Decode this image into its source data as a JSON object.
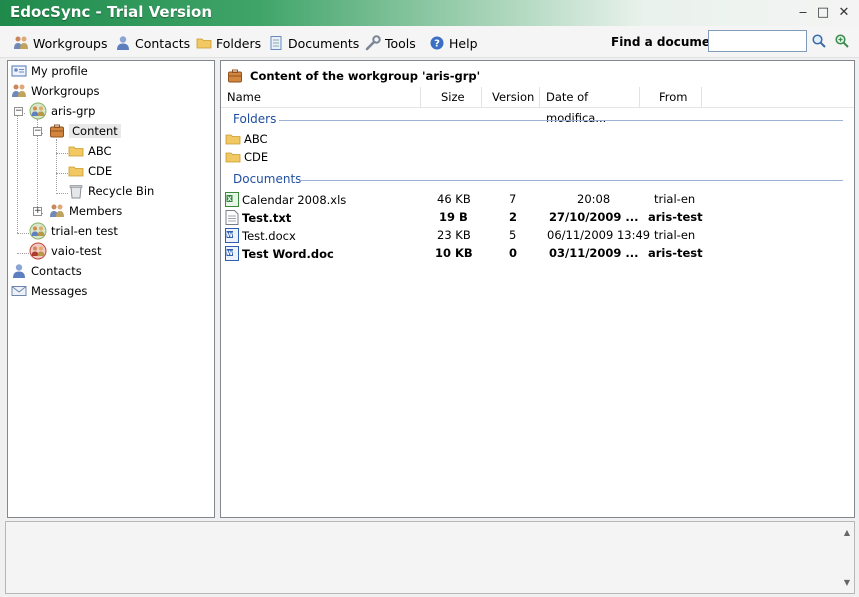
{
  "window": {
    "title": "EdocSync - Trial Version",
    "minimize_glyph": "‒",
    "maximize_glyph": "□",
    "close_glyph": "✕"
  },
  "menu": {
    "items": [
      {
        "label": "Workgroups",
        "icon": "workgroups-icon"
      },
      {
        "label": "Contacts",
        "icon": "contacts-icon"
      },
      {
        "label": "Folders",
        "icon": "folder-icon"
      },
      {
        "label": "Documents",
        "icon": "document-icon"
      },
      {
        "label": "Tools",
        "icon": "wrench-icon"
      },
      {
        "label": "Help",
        "icon": "help-icon"
      }
    ],
    "find_label": "Find a document",
    "find_value": ""
  },
  "tree": {
    "nodes": [
      {
        "label": "My profile",
        "icon": "profile-card-icon"
      },
      {
        "label": "Workgroups",
        "icon": "workgroups-icon"
      },
      {
        "label": "aris-grp",
        "icon": "group-icon"
      },
      {
        "label": "Content",
        "icon": "briefcase-icon"
      },
      {
        "label": "ABC",
        "icon": "folder-icon"
      },
      {
        "label": "CDE",
        "icon": "folder-icon"
      },
      {
        "label": "Recycle Bin",
        "icon": "recycle-bin-icon"
      },
      {
        "label": "Members",
        "icon": "members-icon"
      },
      {
        "label": "trial-en test",
        "icon": "group-icon"
      },
      {
        "label": "vaio-test",
        "icon": "group-error-icon"
      },
      {
        "label": "Contacts",
        "icon": "contacts-icon"
      },
      {
        "label": "Messages",
        "icon": "envelope-icon"
      }
    ],
    "expander_minus": "−",
    "expander_plus": "+"
  },
  "content": {
    "header": "Content of the workgroup 'aris-grp'",
    "columns": [
      "Name",
      "Size",
      "Version",
      "Date of modifica...",
      "From"
    ],
    "folders_label": "Folders",
    "folders": [
      "ABC",
      "CDE"
    ],
    "documents_label": "Documents",
    "documents": [
      {
        "name": "Calendar 2008.xls",
        "size": "46 KB",
        "version": "7",
        "date": "20:08",
        "from": "trial-en",
        "bold": false,
        "icon": "excel-icon"
      },
      {
        "name": "Test.txt",
        "size": "19 B",
        "version": "2",
        "date": "27/10/2009 ...",
        "from": "aris-test",
        "bold": true,
        "icon": "text-file-icon"
      },
      {
        "name": "Test.docx",
        "size": "23 KB",
        "version": "5",
        "date": "06/11/2009 13:49",
        "from": "trial-en",
        "bold": false,
        "icon": "word-icon"
      },
      {
        "name": "Test Word.doc",
        "size": "10 KB",
        "version": "0",
        "date": "03/11/2009 ...",
        "from": "aris-test",
        "bold": true,
        "icon": "word-icon"
      }
    ]
  },
  "bottom": {
    "scroll_up_glyph": "▲",
    "scroll_down_glyph": "▼"
  }
}
